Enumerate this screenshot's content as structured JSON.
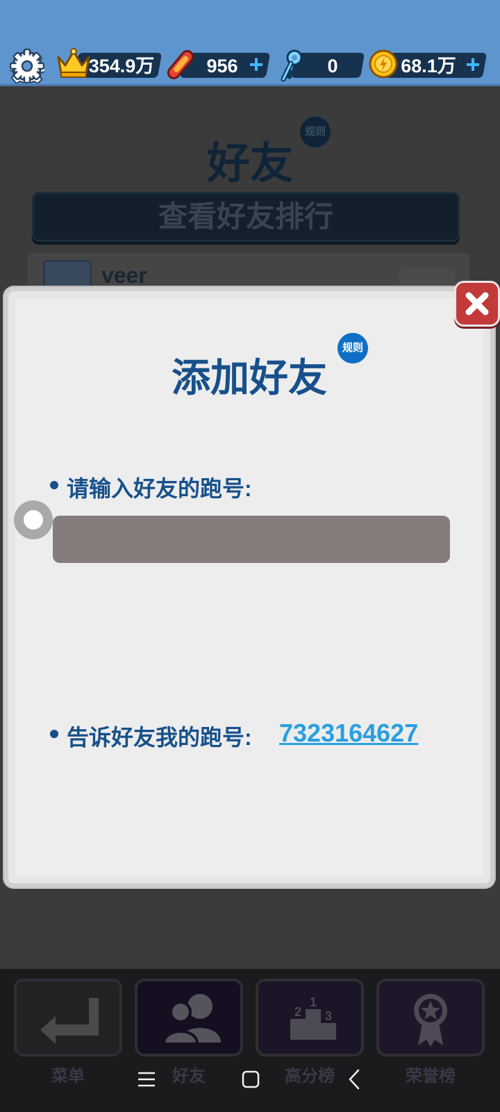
{
  "topbar": {
    "crowns": "354.9万",
    "boards": "956",
    "keys": "0",
    "coins": "68.1万",
    "icons": [
      "gear-icon",
      "crown-icon",
      "hoverboard-icon",
      "key-icon",
      "coin-icon",
      "plus-icon"
    ]
  },
  "background_page": {
    "title": "好友",
    "rule_badge": "规则",
    "rank_button": "查看好友排行",
    "friend_row": {
      "name": "veer"
    }
  },
  "modal": {
    "title": "添加好友",
    "rule_badge": "规则",
    "input_label": "请输入好友的跑号:",
    "input_value": "",
    "share_label": "告诉好友我的跑号:",
    "my_id": "7323164627"
  },
  "bottom_nav": {
    "items": [
      {
        "label": "菜单",
        "icon": "return-arrow-icon"
      },
      {
        "label": "好友",
        "icon": "friends-icon"
      },
      {
        "label": "高分榜",
        "icon": "podium-icon"
      },
      {
        "label": "荣誉榜",
        "icon": "medal-icon"
      }
    ]
  },
  "system_nav": {
    "icons": [
      "menu-icon",
      "home-icon",
      "back-icon"
    ]
  },
  "colors": {
    "accent_blue": "#17508a",
    "link_blue": "#2a9fe0",
    "close_red": "#c23a3a",
    "top_bar": "#5f95cf"
  }
}
